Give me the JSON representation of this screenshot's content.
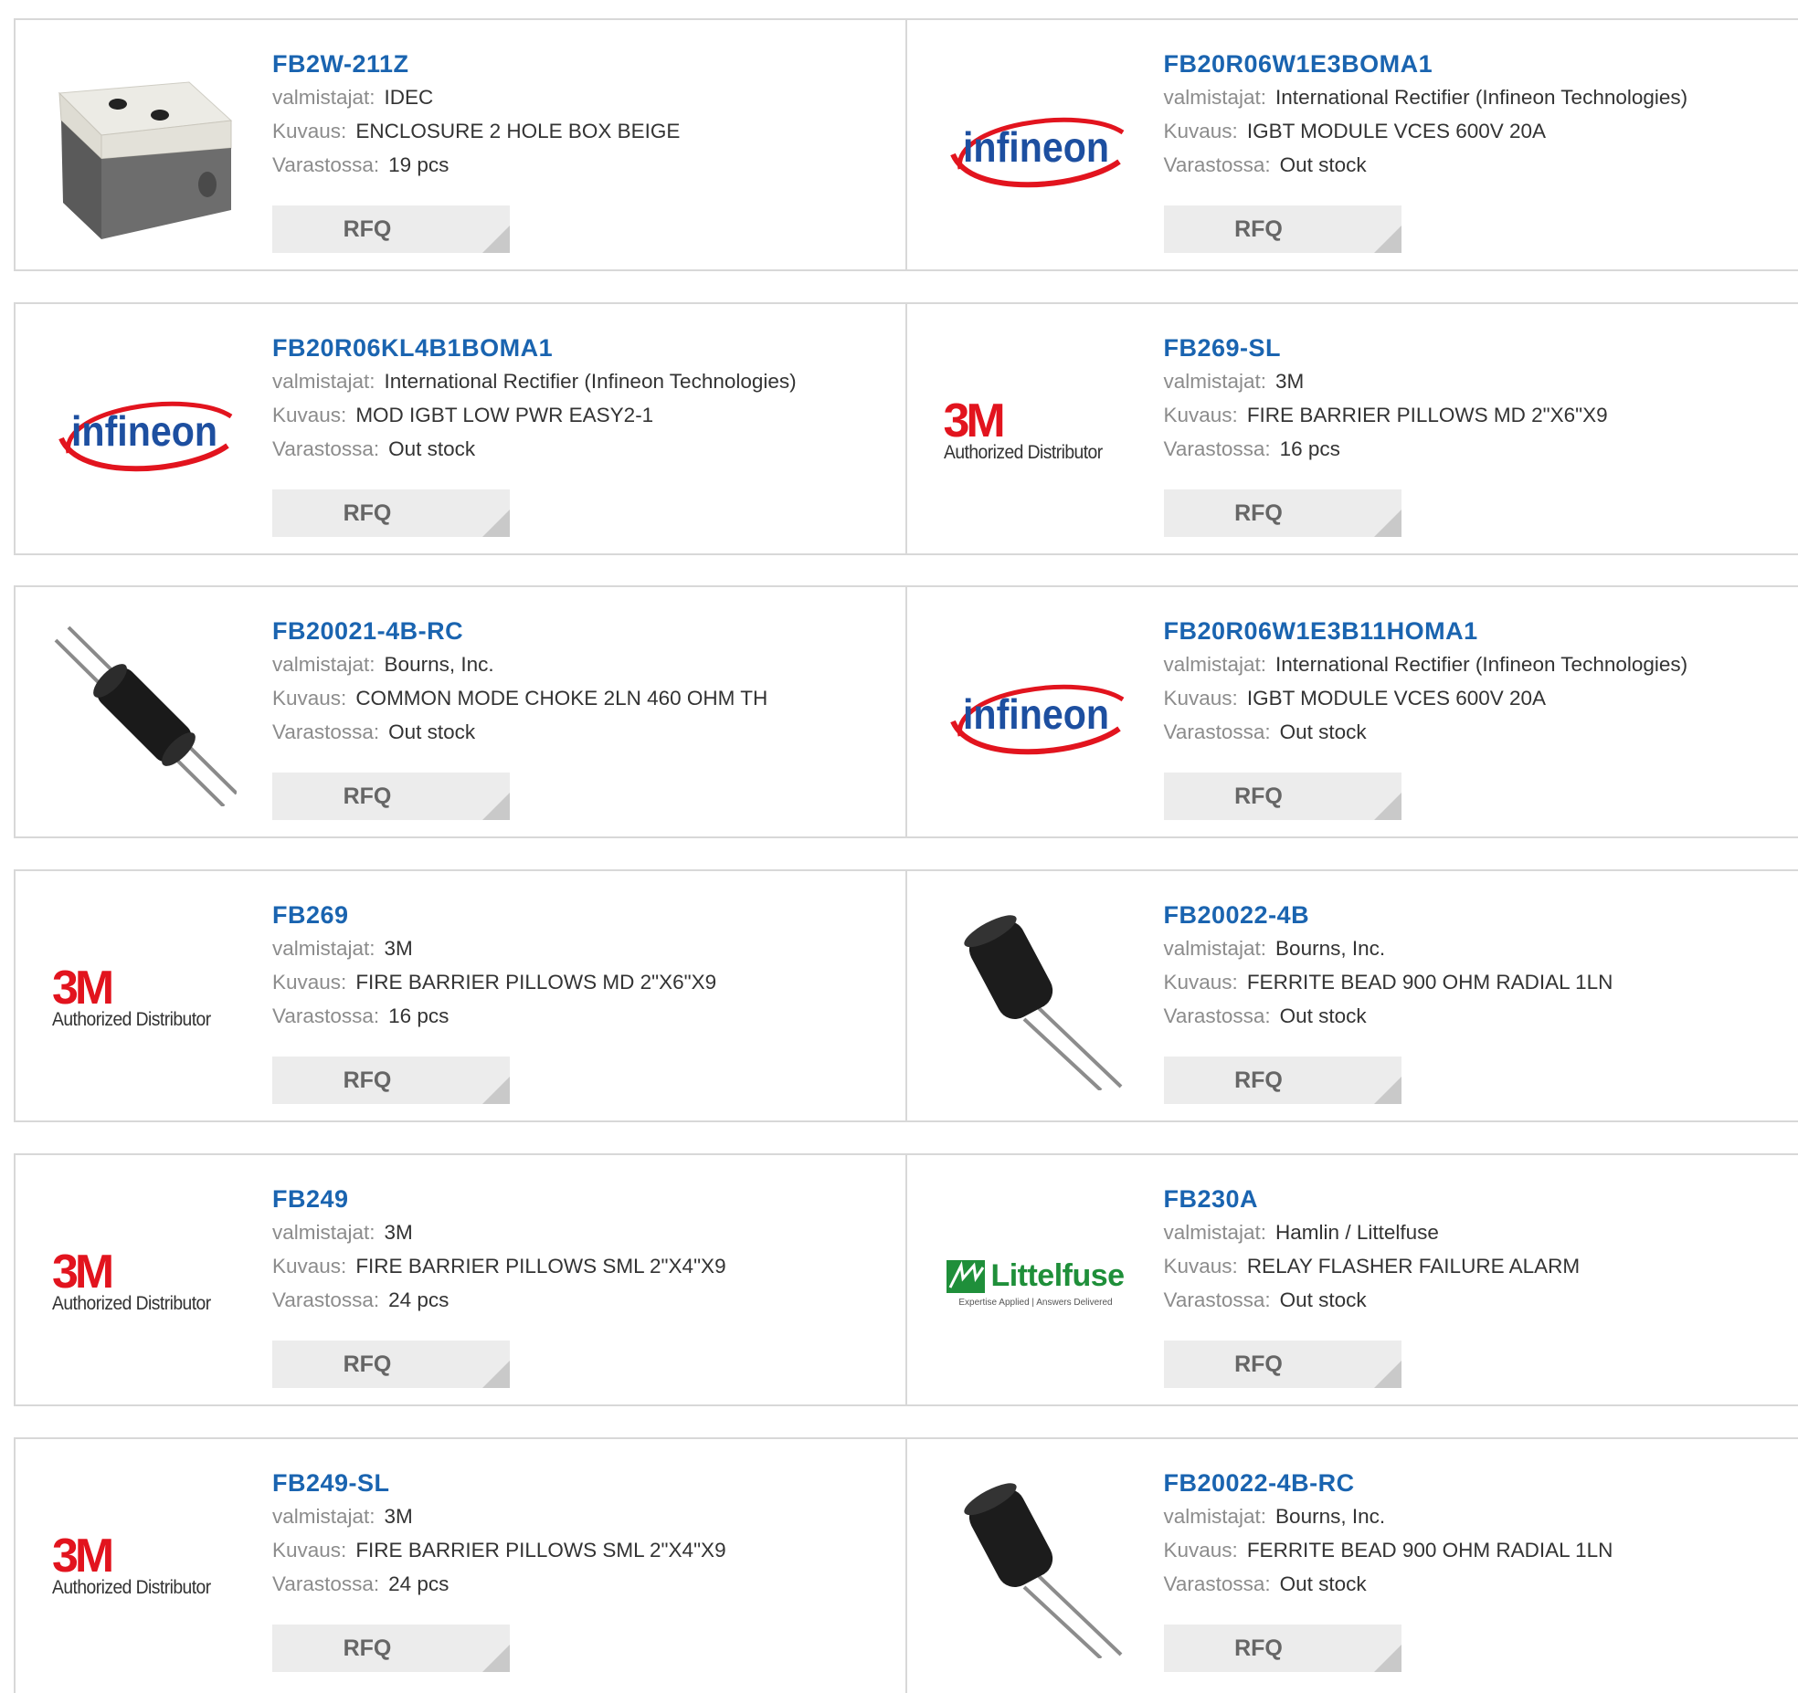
{
  "labels": {
    "manufacturer": "valmistajat:",
    "description": "Kuvaus:",
    "stock": "Varastossa:",
    "rfq": "RFQ"
  },
  "colors": {
    "part_link": "#1a64b0",
    "label_gray": "#8c8c8c",
    "value_text": "#333333",
    "rfq_bg": "#ececec",
    "infineon_red": "#e2141e",
    "infineon_blue": "#1d4fa0",
    "mark_3m_red": "#e2141e",
    "littelfuse_green": "#1f8f3a"
  },
  "products": [
    {
      "part": "FB2W-211Z",
      "manufacturer": "IDEC",
      "description": "ENCLOSURE 2 HOLE BOX BEIGE",
      "stock": "19 pcs",
      "image": "enclosure-photo"
    },
    {
      "part": "FB20R06W1E3BOMA1",
      "manufacturer": "International Rectifier (Infineon Technologies)",
      "description": "IGBT MODULE VCES 600V 20A",
      "stock": "Out stock",
      "image": "infineon-logo",
      "logo_text": "infineon"
    },
    {
      "part": "FB20R06KL4B1BOMA1",
      "manufacturer": "International Rectifier (Infineon Technologies)",
      "description": "MOD IGBT LOW PWR EASY2-1",
      "stock": "Out stock",
      "image": "infineon-logo",
      "logo_text": "infineon"
    },
    {
      "part": "FB269-SL",
      "manufacturer": "3M",
      "description": "FIRE BARRIER PILLOWS MD 2\"X6\"X9",
      "stock": "16 pcs",
      "image": "3m-logo",
      "logo_text": "3M",
      "logo_sub": "Authorized Distributor"
    },
    {
      "part": "FB20021-4B-RC",
      "manufacturer": "Bourns, Inc.",
      "description": "COMMON MODE CHOKE 2LN 460 OHM TH",
      "stock": "Out stock",
      "image": "choke-photo"
    },
    {
      "part": "FB20R06W1E3B11HOMA1",
      "manufacturer": "International Rectifier (Infineon Technologies)",
      "description": "IGBT MODULE VCES 600V 20A",
      "stock": "Out stock",
      "image": "infineon-logo",
      "logo_text": "infineon"
    },
    {
      "part": "FB269",
      "manufacturer": "3M",
      "description": "FIRE BARRIER PILLOWS MD 2\"X6\"X9",
      "stock": "16 pcs",
      "image": "3m-logo",
      "logo_text": "3M",
      "logo_sub": "Authorized Distributor"
    },
    {
      "part": "FB20022-4B",
      "manufacturer": "Bourns, Inc.",
      "description": "FERRITE BEAD 900 OHM RADIAL 1LN",
      "stock": "Out stock",
      "image": "ferrite-bead-photo"
    },
    {
      "part": "FB249",
      "manufacturer": "3M",
      "description": "FIRE BARRIER PILLOWS SML 2\"X4\"X9",
      "stock": "24 pcs",
      "image": "3m-logo",
      "logo_text": "3M",
      "logo_sub": "Authorized Distributor"
    },
    {
      "part": "FB230A",
      "manufacturer": "Hamlin / Littelfuse",
      "description": "RELAY FLASHER FAILURE ALARM",
      "stock": "Out stock",
      "image": "littelfuse-logo",
      "logo_text": "Littelfuse",
      "logo_sub": "Expertise Applied | Answers Delivered"
    },
    {
      "part": "FB249-SL",
      "manufacturer": "3M",
      "description": "FIRE BARRIER PILLOWS SML 2\"X4\"X9",
      "stock": "24 pcs",
      "image": "3m-logo",
      "logo_text": "3M",
      "logo_sub": "Authorized Distributor"
    },
    {
      "part": "FB20022-4B-RC",
      "manufacturer": "Bourns, Inc.",
      "description": "FERRITE BEAD 900 OHM RADIAL 1LN",
      "stock": "Out stock",
      "image": "ferrite-bead-photo"
    }
  ]
}
